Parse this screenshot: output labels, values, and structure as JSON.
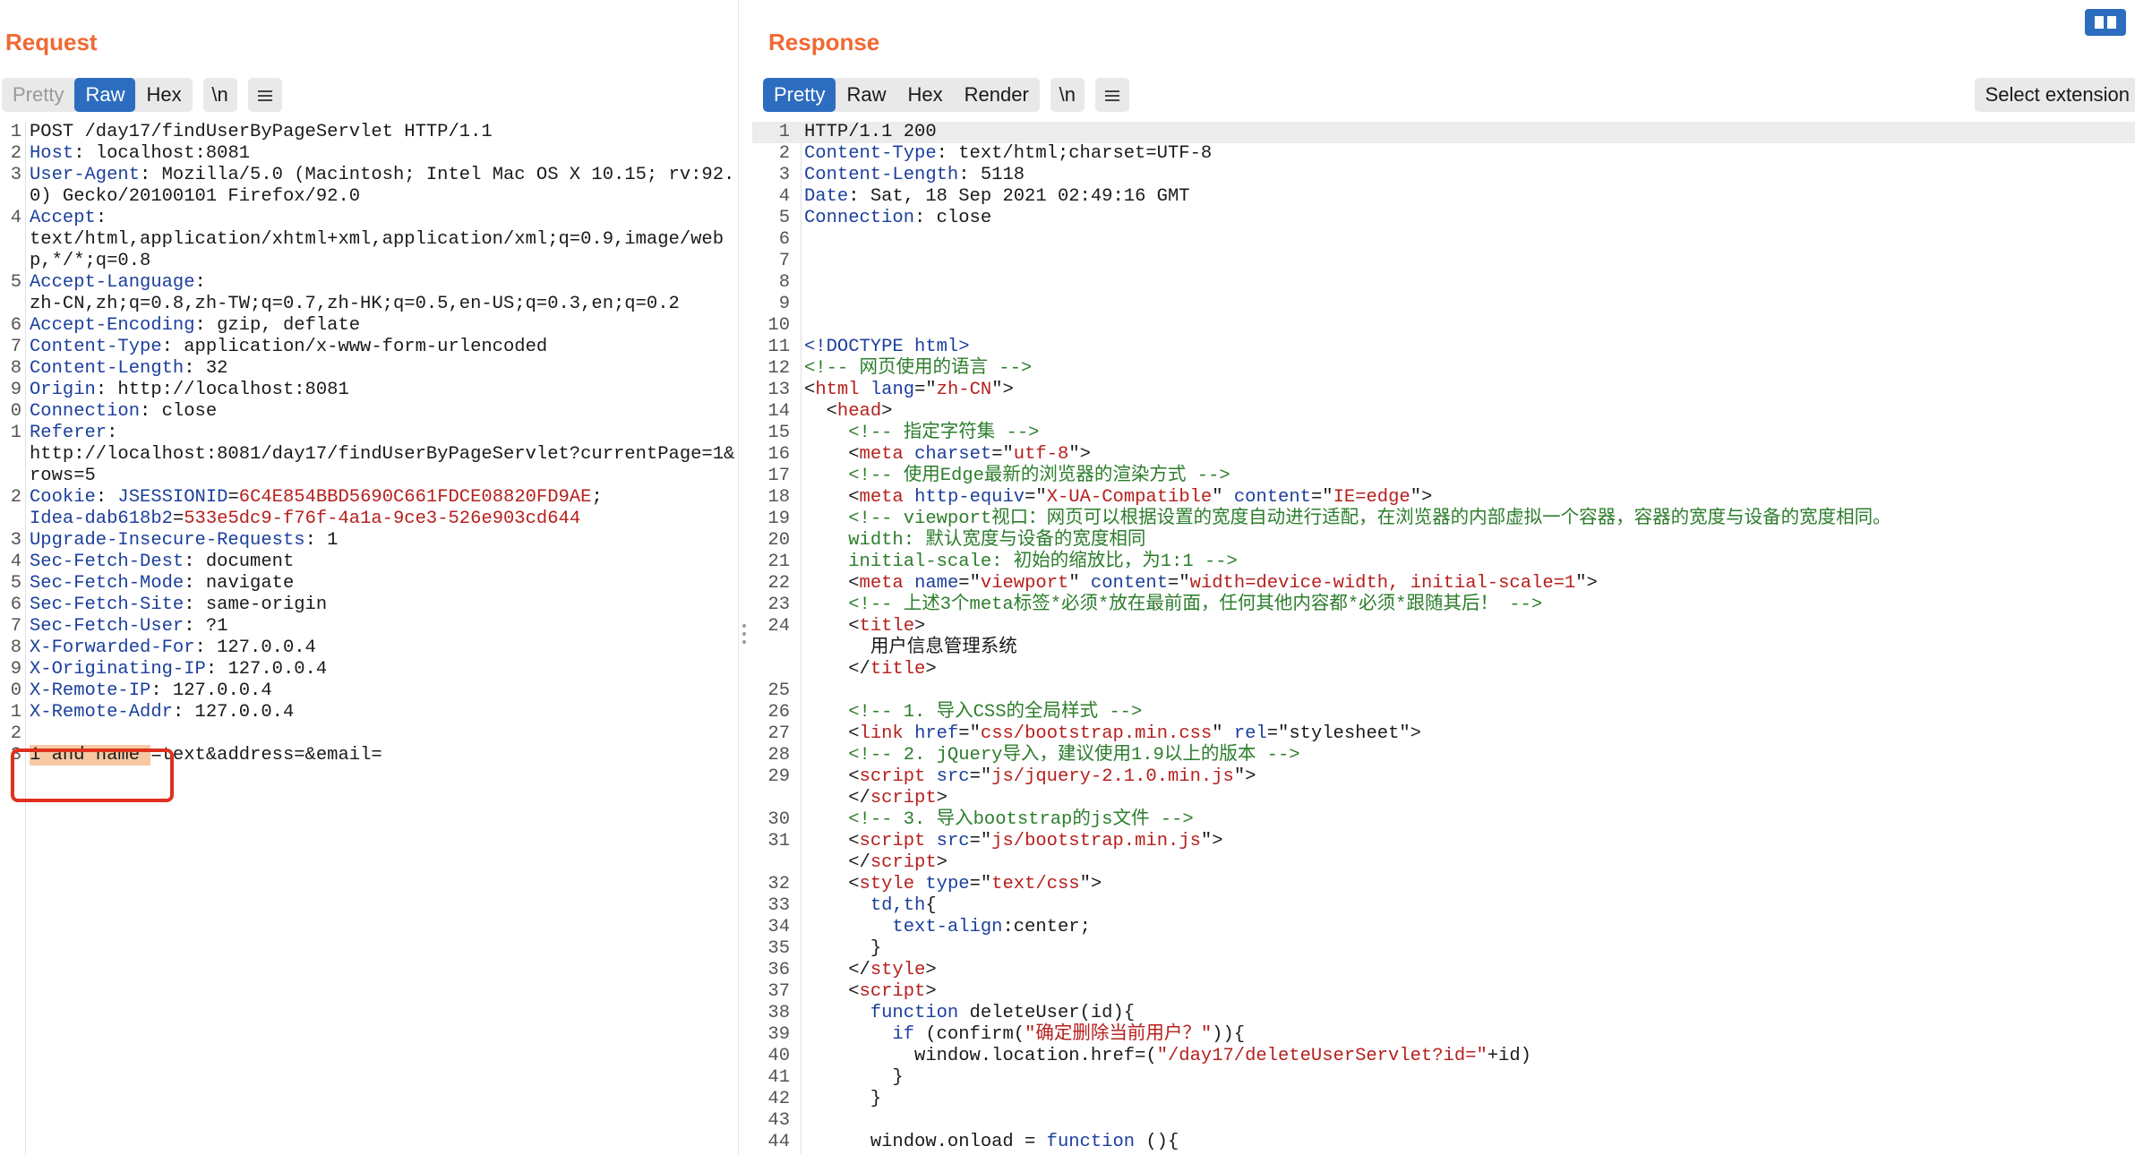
{
  "request": {
    "title": "Request",
    "tabs": [
      "Pretty",
      "Raw",
      "Hex"
    ],
    "newline_label": "\\n",
    "lines": [
      {
        "n": "1",
        "parts": [
          {
            "t": "POST /day17/findUserByPageServlet HTTP/1.1",
            "c": ""
          }
        ]
      },
      {
        "n": "2",
        "parts": [
          {
            "t": "Host",
            "c": "k"
          },
          {
            "t": ": localhost:8081",
            "c": ""
          }
        ]
      },
      {
        "n": "3",
        "parts": [
          {
            "t": "User-Agent",
            "c": "k"
          },
          {
            "t": ": Mozilla/5.0 (Macintosh; Intel Mac OS X 10.15; rv:92.0) Gecko/20100101 Firefox/92.0",
            "c": ""
          }
        ]
      },
      {
        "n": "4",
        "parts": [
          {
            "t": "Accept",
            "c": "k"
          },
          {
            "t": ":\ntext/html,application/xhtml+xml,application/xml;q=0.9,image/webp,*/*;q=0.8",
            "c": ""
          }
        ]
      },
      {
        "n": "5",
        "parts": [
          {
            "t": "Accept-Language",
            "c": "k"
          },
          {
            "t": ":\nzh-CN,zh;q=0.8,zh-TW;q=0.7,zh-HK;q=0.5,en-US;q=0.3,en;q=0.2",
            "c": ""
          }
        ]
      },
      {
        "n": "6",
        "parts": [
          {
            "t": "Accept-Encoding",
            "c": "k"
          },
          {
            "t": ": gzip, deflate",
            "c": ""
          }
        ]
      },
      {
        "n": "7",
        "parts": [
          {
            "t": "Content-Type",
            "c": "k"
          },
          {
            "t": ": application/x-www-form-urlencoded",
            "c": ""
          }
        ]
      },
      {
        "n": "8",
        "parts": [
          {
            "t": "Content-Length",
            "c": "k"
          },
          {
            "t": ": 32",
            "c": ""
          }
        ]
      },
      {
        "n": "9",
        "parts": [
          {
            "t": "Origin",
            "c": "k"
          },
          {
            "t": ": http://localhost:8081",
            "c": ""
          }
        ]
      },
      {
        "n": "0",
        "parts": [
          {
            "t": "Connection",
            "c": "k"
          },
          {
            "t": ": close",
            "c": ""
          }
        ]
      },
      {
        "n": "1",
        "parts": [
          {
            "t": "Referer",
            "c": "k"
          },
          {
            "t": ":\nhttp://localhost:8081/day17/findUserByPageServlet?currentPage=1&rows=5",
            "c": ""
          }
        ]
      },
      {
        "n": "2",
        "parts": [
          {
            "t": "Cookie",
            "c": "k"
          },
          {
            "t": ": ",
            "c": ""
          },
          {
            "t": "JSESSIONID",
            "c": "k"
          },
          {
            "t": "=",
            "c": ""
          },
          {
            "t": "6C4E854BBD5690C661FDCE08820FD9AE",
            "c": "str"
          },
          {
            "t": ";\n",
            "c": ""
          },
          {
            "t": "Idea-dab618b2",
            "c": "k"
          },
          {
            "t": "=",
            "c": ""
          },
          {
            "t": "533e5dc9-f76f-4a1a-9ce3-526e903cd644",
            "c": "str"
          }
        ]
      },
      {
        "n": "3",
        "parts": [
          {
            "t": "Upgrade-Insecure-Requests",
            "c": "k"
          },
          {
            "t": ": 1",
            "c": ""
          }
        ]
      },
      {
        "n": "4",
        "parts": [
          {
            "t": "Sec-Fetch-Dest",
            "c": "k"
          },
          {
            "t": ": document",
            "c": ""
          }
        ]
      },
      {
        "n": "5",
        "parts": [
          {
            "t": "Sec-Fetch-Mode",
            "c": "k"
          },
          {
            "t": ": navigate",
            "c": ""
          }
        ]
      },
      {
        "n": "6",
        "parts": [
          {
            "t": "Sec-Fetch-Site",
            "c": "k"
          },
          {
            "t": ": same-origin",
            "c": ""
          }
        ]
      },
      {
        "n": "7",
        "parts": [
          {
            "t": "Sec-Fetch-User",
            "c": "k"
          },
          {
            "t": ": ?1",
            "c": ""
          }
        ]
      },
      {
        "n": "8",
        "parts": [
          {
            "t": "X-Forwarded-For",
            "c": "k"
          },
          {
            "t": ": 127.0.0.4",
            "c": ""
          }
        ]
      },
      {
        "n": "9",
        "parts": [
          {
            "t": "X-Originating-IP",
            "c": "k"
          },
          {
            "t": ": 127.0.0.4",
            "c": ""
          }
        ]
      },
      {
        "n": "0",
        "parts": [
          {
            "t": "X-Remote-IP",
            "c": "k"
          },
          {
            "t": ": 127.0.0.4",
            "c": ""
          }
        ]
      },
      {
        "n": "1",
        "parts": [
          {
            "t": "X-Remote-Addr",
            "c": "k"
          },
          {
            "t": ": 127.0.0.4",
            "c": ""
          }
        ]
      },
      {
        "n": "2",
        "parts": [
          {
            "t": "",
            "c": ""
          }
        ]
      },
      {
        "n": "3",
        "parts": [
          {
            "t": "1 and name ",
            "c": "sel-text"
          },
          {
            "t": "=text&address=&email=",
            "c": ""
          }
        ]
      }
    ]
  },
  "response": {
    "title": "Response",
    "tabs": [
      "Pretty",
      "Raw",
      "Hex",
      "Render"
    ],
    "newline_label": "\\n",
    "select_extension_label": "Select extension",
    "lines": [
      {
        "n": "1",
        "parts": [
          {
            "t": "HTTP/1.1 200",
            "c": ""
          }
        ]
      },
      {
        "n": "2",
        "parts": [
          {
            "t": "Content-Type",
            "c": "k"
          },
          {
            "t": ": text/html;charset=UTF-8",
            "c": ""
          }
        ]
      },
      {
        "n": "3",
        "parts": [
          {
            "t": "Content-Length",
            "c": "k"
          },
          {
            "t": ": 5118",
            "c": ""
          }
        ]
      },
      {
        "n": "4",
        "parts": [
          {
            "t": "Date",
            "c": "k"
          },
          {
            "t": ": Sat, 18 Sep 2021 02:49:16 GMT",
            "c": ""
          }
        ]
      },
      {
        "n": "5",
        "parts": [
          {
            "t": "Connection",
            "c": "k"
          },
          {
            "t": ": close",
            "c": ""
          }
        ]
      },
      {
        "n": "6",
        "parts": [
          {
            "t": "",
            "c": ""
          }
        ]
      },
      {
        "n": "7",
        "parts": [
          {
            "t": "",
            "c": ""
          }
        ]
      },
      {
        "n": "8",
        "parts": [
          {
            "t": "",
            "c": ""
          }
        ]
      },
      {
        "n": "9",
        "parts": [
          {
            "t": "",
            "c": ""
          }
        ]
      },
      {
        "n": "10",
        "parts": [
          {
            "t": "",
            "c": ""
          }
        ]
      },
      {
        "n": "11",
        "parts": [
          {
            "t": "<!DOCTYPE html>",
            "c": "kw"
          }
        ]
      },
      {
        "n": "12",
        "parts": [
          {
            "t": "<!-- 网页使用的语言 -->",
            "c": "cm"
          }
        ]
      },
      {
        "n": "13",
        "parts": [
          {
            "t": "<",
            "c": ""
          },
          {
            "t": "html",
            "c": "tag"
          },
          {
            "t": " ",
            "c": ""
          },
          {
            "t": "lang",
            "c": "attr"
          },
          {
            "t": "=\"",
            "c": ""
          },
          {
            "t": "zh-CN",
            "c": "str"
          },
          {
            "t": "\">",
            "c": ""
          }
        ]
      },
      {
        "n": "14",
        "parts": [
          {
            "t": "  <",
            "c": ""
          },
          {
            "t": "head",
            "c": "tag"
          },
          {
            "t": ">",
            "c": ""
          }
        ]
      },
      {
        "n": "15",
        "parts": [
          {
            "t": "    <!-- 指定字符集 -->",
            "c": "cm"
          }
        ]
      },
      {
        "n": "16",
        "parts": [
          {
            "t": "    <",
            "c": ""
          },
          {
            "t": "meta",
            "c": "tag"
          },
          {
            "t": " ",
            "c": ""
          },
          {
            "t": "charset",
            "c": "attr"
          },
          {
            "t": "=\"",
            "c": ""
          },
          {
            "t": "utf-8",
            "c": "str"
          },
          {
            "t": "\">",
            "c": ""
          }
        ]
      },
      {
        "n": "17",
        "parts": [
          {
            "t": "    <!-- 使用Edge最新的浏览器的渲染方式 -->",
            "c": "cm"
          }
        ]
      },
      {
        "n": "18",
        "parts": [
          {
            "t": "    <",
            "c": ""
          },
          {
            "t": "meta",
            "c": "tag"
          },
          {
            "t": " ",
            "c": ""
          },
          {
            "t": "http-equiv",
            "c": "attr"
          },
          {
            "t": "=\"",
            "c": ""
          },
          {
            "t": "X-UA-Compatible",
            "c": "str"
          },
          {
            "t": "\" ",
            "c": ""
          },
          {
            "t": "content",
            "c": "attr"
          },
          {
            "t": "=\"",
            "c": ""
          },
          {
            "t": "IE=edge",
            "c": "str"
          },
          {
            "t": "\">",
            "c": ""
          }
        ]
      },
      {
        "n": "19",
        "parts": [
          {
            "t": "    <!-- viewport视口：网页可以根据设置的宽度自动进行适配，在浏览器的内部虚拟一个容器，容器的宽度与设备的宽度相同。",
            "c": "cm"
          }
        ]
      },
      {
        "n": "20",
        "parts": [
          {
            "t": "    width: 默认宽度与设备的宽度相同",
            "c": "cm"
          }
        ]
      },
      {
        "n": "21",
        "parts": [
          {
            "t": "    initial-scale: 初始的缩放比，为1:1 -->",
            "c": "cm"
          }
        ]
      },
      {
        "n": "22",
        "parts": [
          {
            "t": "    <",
            "c": ""
          },
          {
            "t": "meta",
            "c": "tag"
          },
          {
            "t": " ",
            "c": ""
          },
          {
            "t": "name",
            "c": "attr"
          },
          {
            "t": "=\"",
            "c": ""
          },
          {
            "t": "viewport",
            "c": "str"
          },
          {
            "t": "\" ",
            "c": ""
          },
          {
            "t": "content",
            "c": "attr"
          },
          {
            "t": "=\"",
            "c": ""
          },
          {
            "t": "width=device-width, initial-scale=1",
            "c": "str"
          },
          {
            "t": "\">",
            "c": ""
          }
        ]
      },
      {
        "n": "23",
        "parts": [
          {
            "t": "    <!-- 上述3个meta标签*必须*放在最前面，任何其他内容都*必须*跟随其后！ -->",
            "c": "cm"
          }
        ]
      },
      {
        "n": "24",
        "parts": [
          {
            "t": "    <",
            "c": ""
          },
          {
            "t": "title",
            "c": "tag"
          },
          {
            "t": ">\n      用户信息管理系统\n    </",
            "c": ""
          },
          {
            "t": "title",
            "c": "tag"
          },
          {
            "t": ">",
            "c": ""
          }
        ]
      },
      {
        "n": "25",
        "parts": [
          {
            "t": "",
            "c": ""
          }
        ]
      },
      {
        "n": "26",
        "parts": [
          {
            "t": "    <!-- 1. 导入CSS的全局样式 -->",
            "c": "cm"
          }
        ]
      },
      {
        "n": "27",
        "parts": [
          {
            "t": "    <",
            "c": ""
          },
          {
            "t": "link",
            "c": "tag"
          },
          {
            "t": " ",
            "c": ""
          },
          {
            "t": "href",
            "c": "attr"
          },
          {
            "t": "=\"",
            "c": ""
          },
          {
            "t": "css/bootstrap.min.css",
            "c": "str"
          },
          {
            "t": "\" ",
            "c": ""
          },
          {
            "t": "rel",
            "c": "attr"
          },
          {
            "t": "=\"stylesheet\">",
            "c": ""
          }
        ]
      },
      {
        "n": "28",
        "parts": [
          {
            "t": "    <!-- 2. jQuery导入，建议使用1.9以上的版本 -->",
            "c": "cm"
          }
        ]
      },
      {
        "n": "29",
        "parts": [
          {
            "t": "    <",
            "c": ""
          },
          {
            "t": "script",
            "c": "tag"
          },
          {
            "t": " ",
            "c": ""
          },
          {
            "t": "src",
            "c": "attr"
          },
          {
            "t": "=\"",
            "c": ""
          },
          {
            "t": "js/jquery-2.1.0.min.js",
            "c": "str"
          },
          {
            "t": "\">\n    </",
            "c": ""
          },
          {
            "t": "script",
            "c": "tag"
          },
          {
            "t": ">",
            "c": ""
          }
        ]
      },
      {
        "n": "30",
        "parts": [
          {
            "t": "    <!-- 3. 导入bootstrap的js文件 -->",
            "c": "cm"
          }
        ]
      },
      {
        "n": "31",
        "parts": [
          {
            "t": "    <",
            "c": ""
          },
          {
            "t": "script",
            "c": "tag"
          },
          {
            "t": " ",
            "c": ""
          },
          {
            "t": "src",
            "c": "attr"
          },
          {
            "t": "=\"",
            "c": ""
          },
          {
            "t": "js/bootstrap.min.js",
            "c": "str"
          },
          {
            "t": "\">\n    </",
            "c": ""
          },
          {
            "t": "script",
            "c": "tag"
          },
          {
            "t": ">",
            "c": ""
          }
        ]
      },
      {
        "n": "32",
        "parts": [
          {
            "t": "    <",
            "c": ""
          },
          {
            "t": "style",
            "c": "tag"
          },
          {
            "t": " ",
            "c": ""
          },
          {
            "t": "type",
            "c": "attr"
          },
          {
            "t": "=\"",
            "c": ""
          },
          {
            "t": "text/css",
            "c": "str"
          },
          {
            "t": "\">",
            "c": ""
          }
        ]
      },
      {
        "n": "33",
        "parts": [
          {
            "t": "      ",
            "c": ""
          },
          {
            "t": "td,th",
            "c": "kw"
          },
          {
            "t": "{",
            "c": ""
          }
        ]
      },
      {
        "n": "34",
        "parts": [
          {
            "t": "        ",
            "c": ""
          },
          {
            "t": "text-align",
            "c": "kw"
          },
          {
            "t": ":center;",
            "c": ""
          }
        ]
      },
      {
        "n": "35",
        "parts": [
          {
            "t": "      }",
            "c": ""
          }
        ]
      },
      {
        "n": "36",
        "parts": [
          {
            "t": "    </",
            "c": ""
          },
          {
            "t": "style",
            "c": "tag"
          },
          {
            "t": ">",
            "c": ""
          }
        ]
      },
      {
        "n": "37",
        "parts": [
          {
            "t": "    <",
            "c": ""
          },
          {
            "t": "script",
            "c": "tag"
          },
          {
            "t": ">",
            "c": ""
          }
        ]
      },
      {
        "n": "38",
        "parts": [
          {
            "t": "      ",
            "c": ""
          },
          {
            "t": "function",
            "c": "kw"
          },
          {
            "t": " deleteUser(id){",
            "c": ""
          }
        ]
      },
      {
        "n": "39",
        "parts": [
          {
            "t": "        ",
            "c": ""
          },
          {
            "t": "if",
            "c": "kw"
          },
          {
            "t": " (confirm(",
            "c": ""
          },
          {
            "t": "\"确定删除当前用户？\"",
            "c": "str"
          },
          {
            "t": ")){",
            "c": ""
          }
        ]
      },
      {
        "n": "40",
        "parts": [
          {
            "t": "          window.location.href=(",
            "c": ""
          },
          {
            "t": "\"/day17/deleteUserServlet?id=\"",
            "c": "str"
          },
          {
            "t": "+id)",
            "c": ""
          }
        ]
      },
      {
        "n": "41",
        "parts": [
          {
            "t": "        }",
            "c": ""
          }
        ]
      },
      {
        "n": "42",
        "parts": [
          {
            "t": "      }",
            "c": ""
          }
        ]
      },
      {
        "n": "43",
        "parts": [
          {
            "t": "",
            "c": ""
          }
        ]
      },
      {
        "n": "44",
        "parts": [
          {
            "t": "      window.onload = ",
            "c": ""
          },
          {
            "t": "function",
            "c": "kw"
          },
          {
            "t": " (){",
            "c": ""
          }
        ]
      }
    ]
  }
}
